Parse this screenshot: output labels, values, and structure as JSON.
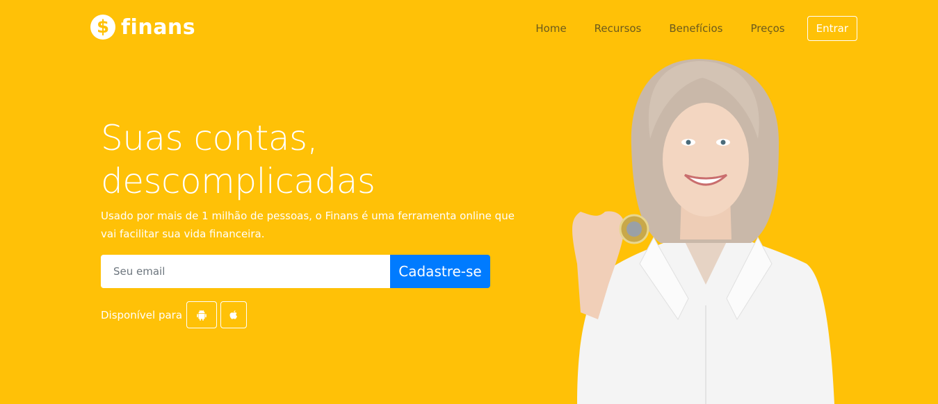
{
  "nav": {
    "brand_symbol": "$",
    "brand_name": "finans",
    "links": [
      "Home",
      "Recursos",
      "Benefícios",
      "Preços"
    ],
    "login_label": "Entrar"
  },
  "hero": {
    "title_line1": "Suas contas,",
    "title_line2": "descomplicadas",
    "subtitle": "Usado por mais de 1 milhão de pessoas, o Finans é uma ferramenta online que vai facilitar sua vida financeira.",
    "email_placeholder": "Seu email",
    "signup_label": "Cadastre-se",
    "available_label": "Disponível para",
    "stores": [
      {
        "icon": "android-icon"
      },
      {
        "icon": "apple-icon"
      }
    ]
  },
  "colors": {
    "background": "#ffc107",
    "button": "#007bff",
    "nav_text": "#6b5a1d"
  }
}
